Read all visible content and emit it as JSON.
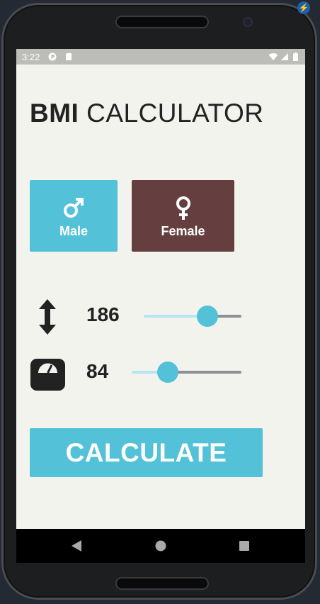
{
  "status_bar": {
    "time": "3:22"
  },
  "header": {
    "title_bold": "BMI",
    "title_rest": "CALCULATOR"
  },
  "gender": {
    "male": {
      "label": "Male",
      "icon": "male-symbol-icon",
      "color": "#53c1d7"
    },
    "female": {
      "label": "Female",
      "icon": "female-symbol-icon",
      "color": "#653f3f"
    }
  },
  "height": {
    "icon": "height-arrows-icon",
    "value": "186",
    "slider_fraction": 0.65
  },
  "weight": {
    "icon": "scale-icon",
    "value": "84",
    "slider_fraction": 0.33
  },
  "calculate": {
    "label": "CALCULATE"
  },
  "colors": {
    "accent": "#53c1d7",
    "female": "#653f3f",
    "background": "#f3f3ee"
  },
  "nav": {
    "back_icon": "back-triangle-icon",
    "home_icon": "home-circle-icon",
    "recents_icon": "recents-square-icon"
  }
}
